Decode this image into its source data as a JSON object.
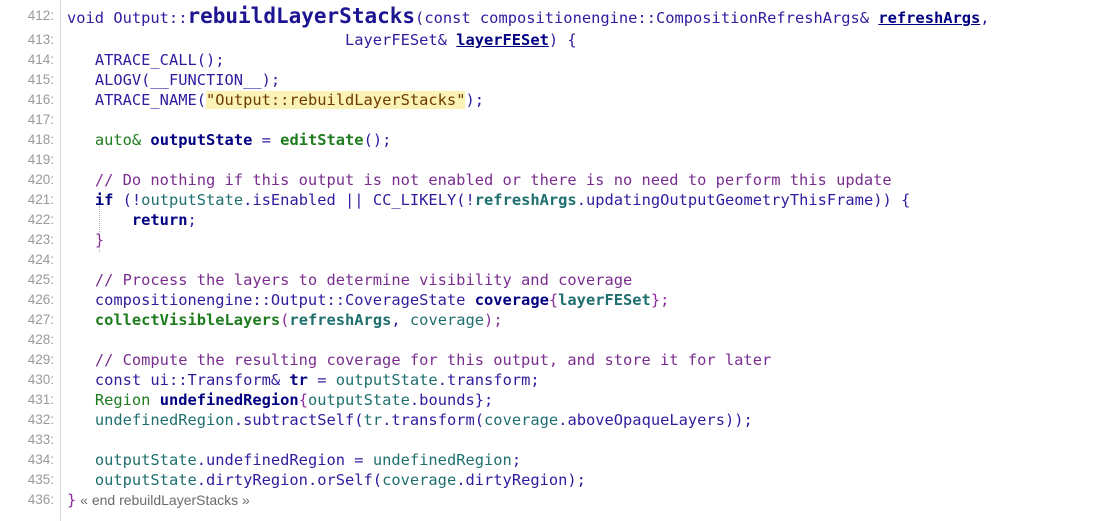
{
  "editor": {
    "line_numbers": [
      "412:",
      "413:",
      "414:",
      "415:",
      "416:",
      "417:",
      "418:",
      "419:",
      "420:",
      "421:",
      "422:",
      "423:",
      "424:",
      "425:",
      "426:",
      "427:",
      "428:",
      "429:",
      "430:",
      "431:",
      "432:",
      "433:",
      "434:",
      "435:",
      "436:"
    ],
    "l412": {
      "a": "void Output::",
      "fn": "rebuildLayerStacks",
      "b": "(const compositionengine::CompositionRefreshArgs& ",
      "param": "refreshArgs",
      "c": ","
    },
    "l413": {
      "a": "LayerFESet& ",
      "param": "layerFESet",
      "b": ") {"
    },
    "l414": "ATRACE_CALL();",
    "l415": "ALOGV(__FUNCTION__);",
    "l416": {
      "a": "ATRACE_NAME(",
      "str": "\"Output::rebuildLayerStacks\"",
      "b": ");"
    },
    "l418": {
      "a": "auto& ",
      "var": "outputState",
      "b": " = ",
      "call": "editState",
      "c": "();"
    },
    "l420": "// Do nothing if this output is not enabled or there is no need to perform this update",
    "l421": {
      "kw": "if",
      "a": " (!",
      "f1": "outputState",
      "b": ".isEnabled || CC_LIKELY(!",
      "f2": "refreshArgs",
      "c": ".updatingOutputGeometryThisFrame)) {"
    },
    "l422": {
      "kw": "return",
      "a": ";"
    },
    "l423": "}",
    "l425": "// Process the layers to determine visibility and coverage",
    "l426": {
      "a": "compositionengine::Output::CoverageState ",
      "var": "coverage",
      "b": "{",
      "arg": "layerFESet",
      "c": "};"
    },
    "l427": {
      "call": "collectVisibleLayers",
      "a": "(",
      "arg1": "refreshArgs",
      "b": ", ",
      "arg2": "coverage",
      "c": ");"
    },
    "l429": "// Compute the resulting coverage for this output, and store it for later",
    "l430": {
      "a": "const ui::Transform& ",
      "var": "tr",
      "b": " = ",
      "f": "outputState",
      "c": ".transform;"
    },
    "l431": {
      "a": "Region ",
      "var": "undefinedRegion",
      "b": "{",
      "f": "outputState",
      "c": ".bounds};"
    },
    "l432": {
      "a": "undefinedRegion",
      "b": ".subtractSelf(",
      "c": "tr",
      "d": ".transform(",
      "e": "coverage",
      "f": ".aboveOpaqueLayers));"
    },
    "l434": {
      "a": "outputState",
      "b": ".undefinedRegion = ",
      "c": "undefinedRegion",
      "d": ";"
    },
    "l435": {
      "a": "outputState",
      "b": ".dirtyRegion.orSelf(",
      "c": "coverage",
      "d": ".dirtyRegion);"
    },
    "l436": {
      "brace": "}",
      "end": " « end rebuildLayerStacks »"
    }
  }
}
